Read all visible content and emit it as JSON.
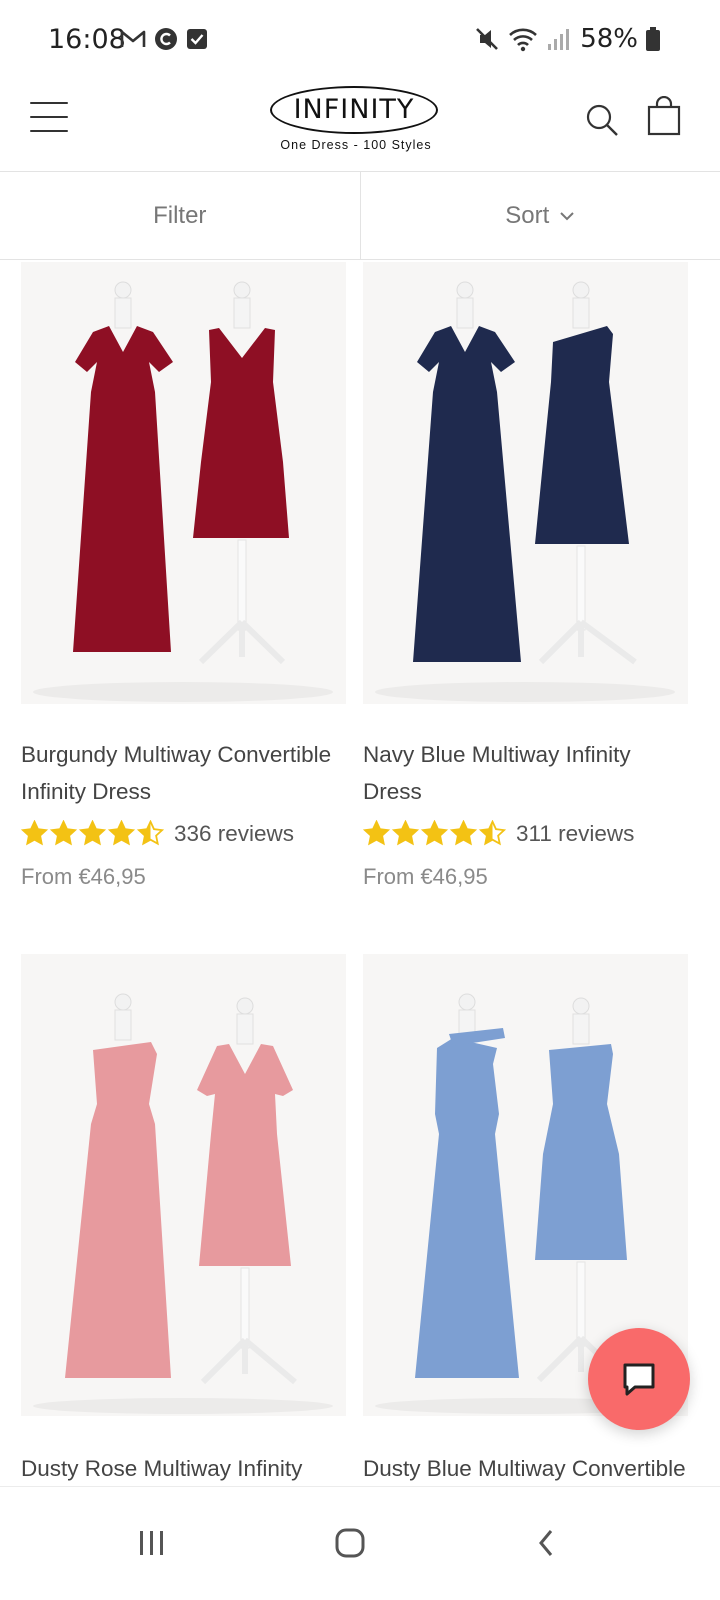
{
  "status_bar": {
    "time": "16:08",
    "battery_percent": "58%",
    "icons": [
      "gmail-icon",
      "c-app-icon",
      "checkbox-icon",
      "mute-icon",
      "wifi-icon",
      "signal-icon",
      "battery-icon"
    ]
  },
  "header": {
    "logo_text": "INFINITY",
    "logo_tagline": "One Dress - 100 Styles"
  },
  "toolbar": {
    "filter_label": "Filter",
    "sort_label": "Sort"
  },
  "products": [
    {
      "title_line1": "Burgundy Multiway Convertible",
      "title_line2": "Infinity Dress",
      "rating": 4.5,
      "reviews": "336 reviews",
      "price": "From €46,95",
      "color": "#8e0f24"
    },
    {
      "title_line1": "Navy Blue Multiway Infinity",
      "title_line2": "Dress",
      "rating": 4.5,
      "reviews": "311 reviews",
      "price": "From €46,95",
      "color": "#1f2a4e"
    },
    {
      "title_line1": "Dusty Rose Multiway Infinity",
      "title_line2": "",
      "color": "#e79a9e"
    },
    {
      "title_line1": "Dusty Blue Multiway Convertible",
      "title_line2": "",
      "color": "#7d9fd2"
    }
  ],
  "colors": {
    "star": "#f3c214",
    "chat_bubble": "#f96a6a"
  }
}
